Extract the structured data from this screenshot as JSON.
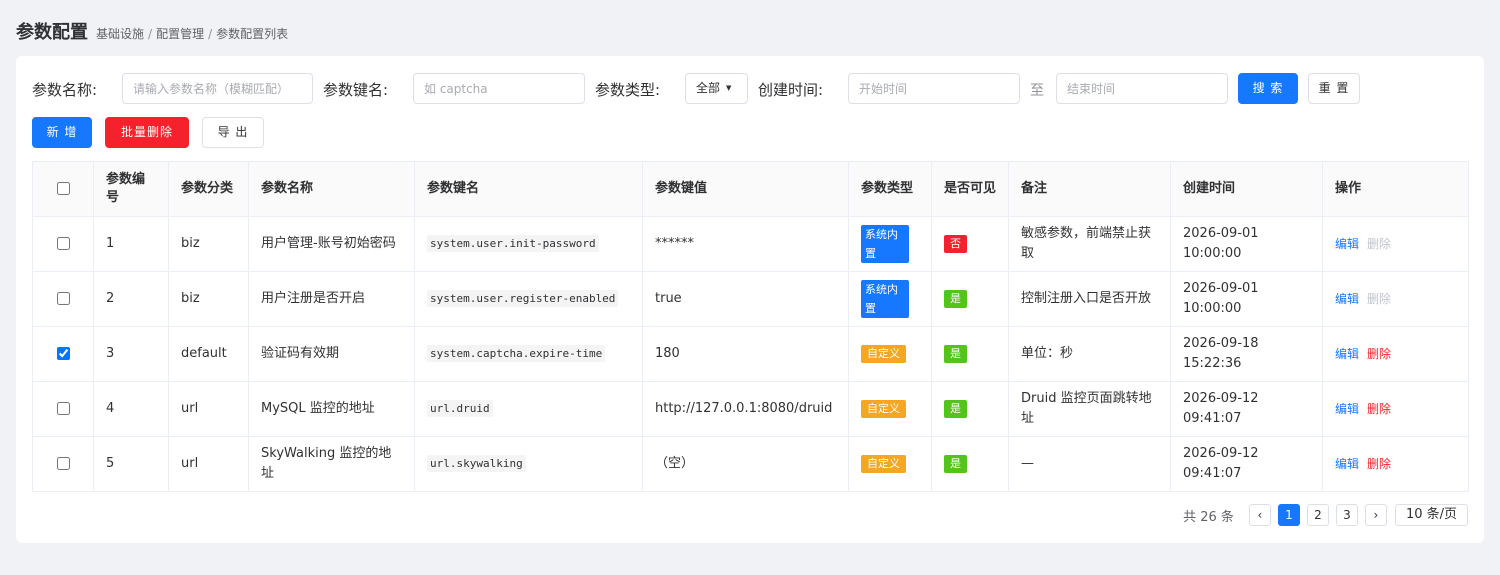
{
  "header": {
    "title": "参数配置",
    "breadcrumb": [
      "基础设施",
      "配置管理",
      "参数配置列表"
    ]
  },
  "filters": {
    "name_label": "参数名称:",
    "name_placeholder": "请输入参数名称（模糊匹配）",
    "key_label": "参数键名:",
    "key_placeholder": "如 captcha",
    "type_label": "参数类型:",
    "type_value": "全部",
    "time_label": "创建时间:",
    "start_placeholder": "开始时间",
    "to": "至",
    "end_placeholder": "结束时间",
    "search": "搜 索",
    "reset": "重 置"
  },
  "actions": {
    "add": "新 增",
    "batch_delete": "批量删除",
    "export": "导 出"
  },
  "table": {
    "columns": [
      "参数编号",
      "参数分类",
      "参数名称",
      "参数键名",
      "参数键值",
      "参数类型",
      "是否可见",
      "备注",
      "创建时间",
      "操作"
    ],
    "rows": [
      {
        "id": "1",
        "category": "biz",
        "name": "用户管理-账号初始密码",
        "key": "system.user.init-password",
        "value": "******",
        "type": "系统内置",
        "visible": "否",
        "remark": "敏感参数，前端禁止获取",
        "created": "2026-09-01 10:00:00",
        "edit": "编辑",
        "delete": "删除"
      },
      {
        "id": "2",
        "category": "biz",
        "name": "用户注册是否开启",
        "key": "system.user.register-enabled",
        "value": "true",
        "type": "系统内置",
        "visible": "是",
        "remark": "控制注册入口是否开放",
        "created": "2026-09-01 10:00:00",
        "edit": "编辑",
        "delete": "删除"
      },
      {
        "id": "3",
        "category": "default",
        "name": "验证码有效期",
        "key": "system.captcha.expire-time",
        "value": "180",
        "type": "自定义",
        "visible": "是",
        "remark": "单位：秒",
        "created": "2026-09-18 15:22:36",
        "edit": "编辑",
        "delete": "删除"
      },
      {
        "id": "4",
        "category": "url",
        "name": "MySQL 监控的地址",
        "key": "url.druid",
        "value": "http://127.0.0.1:8080/druid",
        "type": "自定义",
        "visible": "是",
        "remark": "Druid 监控页面跳转地址",
        "created": "2026-09-12 09:41:07",
        "edit": "编辑",
        "delete": "删除"
      },
      {
        "id": "5",
        "category": "url",
        "name": "SkyWalking 监控的地址",
        "key": "url.skywalking",
        "value": "（空）",
        "type": "自定义",
        "visible": "是",
        "remark": "—",
        "created": "2026-09-12 09:41:07",
        "edit": "编辑",
        "delete": "删除"
      }
    ]
  },
  "pagination": {
    "total": "共 26 条",
    "prev": "‹",
    "pages": [
      "1",
      "2",
      "3"
    ],
    "next": "›",
    "page_size": "10 条/页"
  },
  "colors": {
    "primary": "#1677ff",
    "danger": "#f5222d",
    "warning": "#f5a623",
    "success": "#52c41a"
  }
}
